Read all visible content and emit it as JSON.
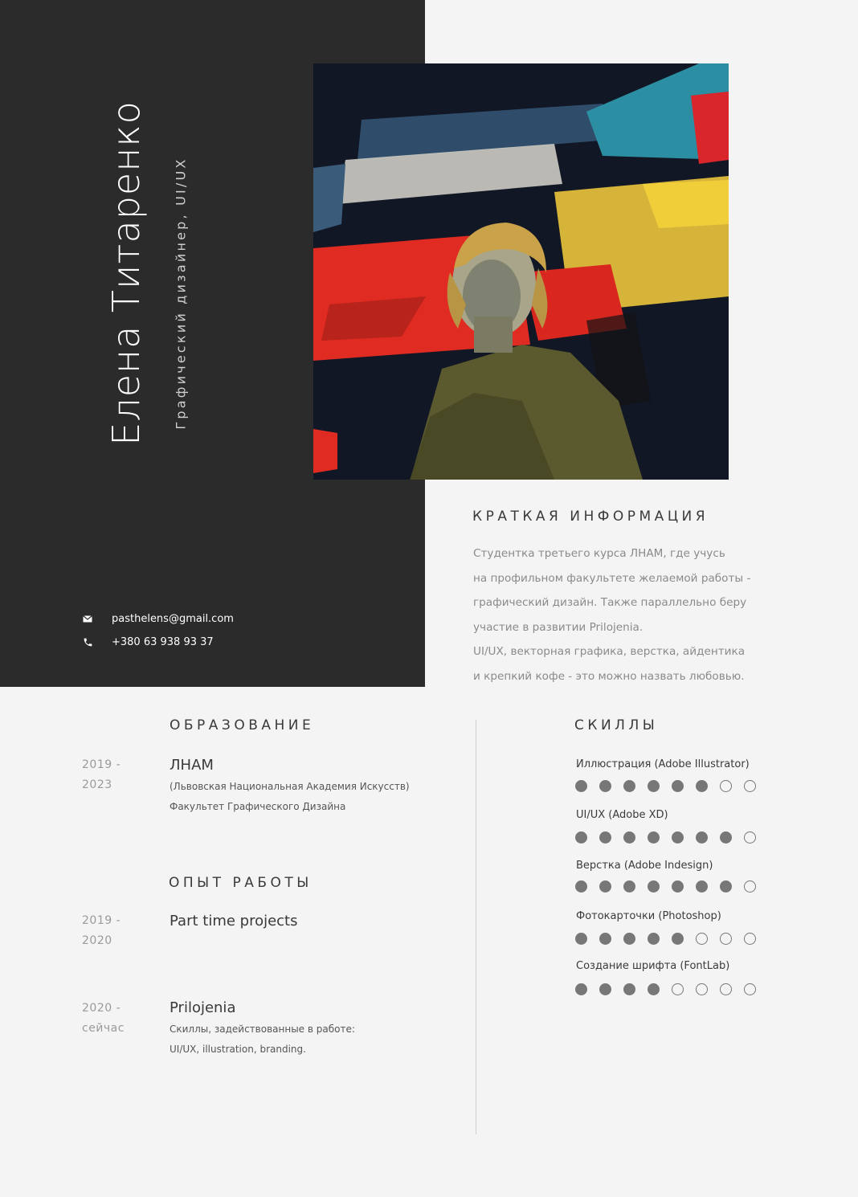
{
  "profile": {
    "name": "Елена Титаренко",
    "role": "Графический дизайнер, UI/UX",
    "email": "pasthelens@gmail.com",
    "phone": "+380 63 938 93 37"
  },
  "about": {
    "title": "КРАТКАЯ ИНФОРМАЦИЯ",
    "lines": [
      "Студентка третьего курса ЛНАМ, где учусь",
      "на профильном факультете желаемой работы -",
      "графический дизайн. Также параллельно беру",
      "участие в развитии Prilojenia.",
      "UI/UX, векторная графика, верстка, айдентика",
      "и крепкий кофе - это можно назвать любовью."
    ]
  },
  "education": {
    "title": "ОБРАЗОВАНИЕ",
    "entries": [
      {
        "year_start": "2019 -",
        "year_end": "2023",
        "title": "ЛНАМ",
        "lines": [
          "(Львовская Национальная Академия Искусств)",
          "Факультет Графического Дизайна"
        ]
      }
    ]
  },
  "experience": {
    "title": "ОПЫТ РАБОТЫ",
    "entries": [
      {
        "year_start": "2019 -",
        "year_end": "2020",
        "title": "Part time projects",
        "lines": []
      },
      {
        "year_start": "2020 -",
        "year_end": "сейчас",
        "title": "Prilojenia",
        "lines": [
          "Скиллы, задействованные в работе:",
          "UI/UX, illustration, branding."
        ]
      }
    ]
  },
  "skills": {
    "title": "СКИЛЛЫ",
    "max_level": 8,
    "items": [
      {
        "label": "Иллюстрация (Adobe Illustrator)",
        "level": 6
      },
      {
        "label": "UI/UX (Adobe XD)",
        "level": 7
      },
      {
        "label": "Верстка (Adobe Indesign)",
        "level": 7
      },
      {
        "label": "Фотокарточки (Photoshop)",
        "level": 5
      },
      {
        "label": "Создание шрифта (FontLab)",
        "level": 4
      }
    ]
  },
  "icons": {
    "email": "envelope-icon",
    "phone": "phone-icon"
  },
  "colors": {
    "dark_panel": "#2b2b2b",
    "background": "#f4f4f4",
    "dot": "#777777"
  }
}
